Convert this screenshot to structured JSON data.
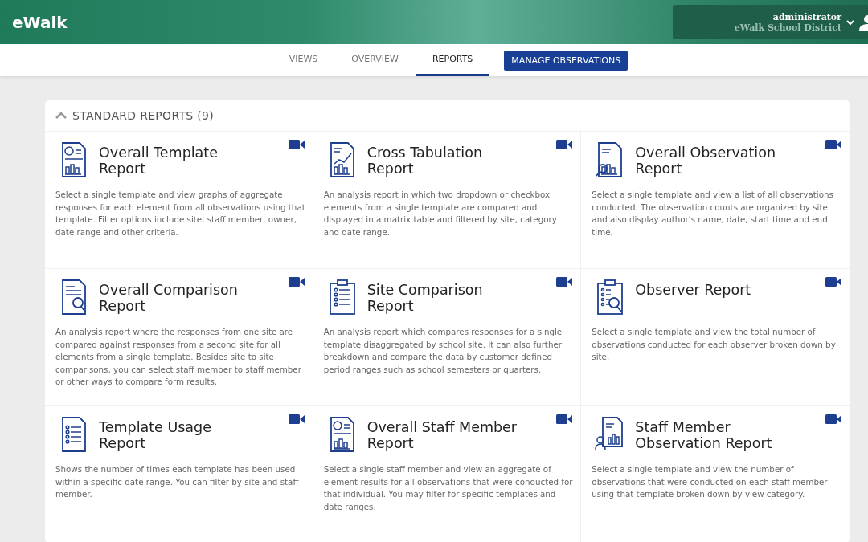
{
  "header": {
    "logo": "eWalk",
    "user": {
      "name": "administrator",
      "organization": "eWalk School District"
    }
  },
  "nav": {
    "tabs": [
      {
        "label": "VIEWS",
        "selected": false
      },
      {
        "label": "OVERVIEW",
        "selected": false
      },
      {
        "label": "REPORTS",
        "selected": true
      }
    ],
    "action": "MANAGE OBSERVATIONS"
  },
  "section": {
    "title": "STANDARD REPORTS (9)",
    "expanded": true,
    "reports": [
      {
        "kind": "doc-chart",
        "title_lines": [
          "Overall Template",
          "Report"
        ],
        "description": "Select a single template and view graphs of aggregate responses for each element from all observations using that template. Filter options include site, staff member, owner, date range and other criteria."
      },
      {
        "kind": "line-chart",
        "title_lines": [
          "Cross Tabulation",
          "Report"
        ],
        "description": "An analysis report in which two dropdown or checkbox elements from a single template are compared and displayed in a matrix table and filtered by site, category and date range."
      },
      {
        "kind": "magnify-chart",
        "title_lines": [
          "Overall Observation",
          "Report"
        ],
        "description": "Select a single template and view a list of all observations conducted. The observation counts are organized by site and also display author's name, date, start time and end time."
      },
      {
        "kind": "magnify-doc",
        "title_lines": [
          "Overall Comparison",
          "Report"
        ],
        "description": "An analysis report where the responses from one site are compared against responses from a second site for all elements from a single template. Besides site to site comparisons, you can select staff member to staff member or other ways to compare form results."
      },
      {
        "kind": "clipboard",
        "title_lines": [
          "Site Comparison",
          "Report"
        ],
        "description": "An analysis report which compares responses for a single template disaggregated by school site. It can also further breakdown and compare the data by customer defined period ranges such as school semesters or quarters."
      },
      {
        "kind": "clipboard-magnify",
        "title_lines": [
          "Observer Report"
        ],
        "description": "Select a single template and view the total number of observations conducted for each observer broken down by site."
      },
      {
        "kind": "list-doc",
        "title_lines": [
          "Template Usage",
          "Report"
        ],
        "description": "Shows the number of times each template has been used within a specific date range. You can filter by site and staff member."
      },
      {
        "kind": "doc-chart",
        "title_lines": [
          "Overall Staff Member",
          "Report"
        ],
        "description": "Select a single staff member and view an aggregate of element results for all observations that were conducted for that individual. You may filter for specific templates and date ranges."
      },
      {
        "kind": "person-chart",
        "title_lines": [
          "Staff Member",
          "Observation Report"
        ],
        "description": "Select a single template and view the number of observations that were conducted on each staff member using that template broken down by view category."
      }
    ]
  }
}
